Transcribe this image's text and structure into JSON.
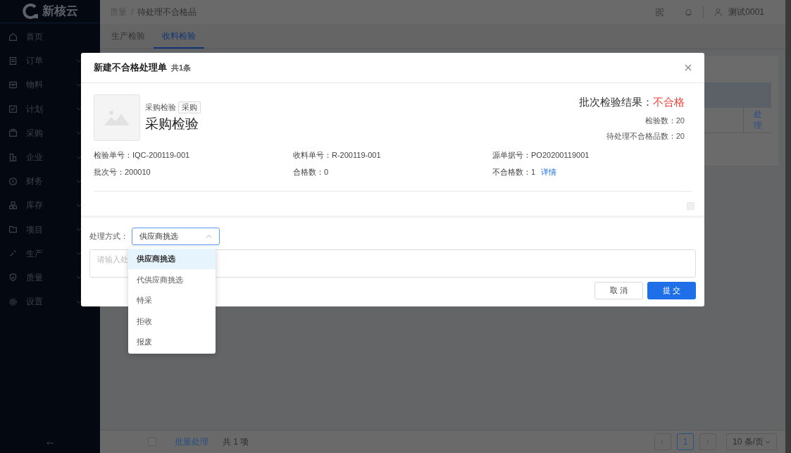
{
  "brand": {
    "name": "新核云"
  },
  "sidebar": {
    "items": [
      {
        "label": "首页",
        "expandable": false
      },
      {
        "label": "订单",
        "expandable": true
      },
      {
        "label": "物料",
        "expandable": true
      },
      {
        "label": "计划",
        "expandable": true
      },
      {
        "label": "采购",
        "expandable": true
      },
      {
        "label": "企业",
        "expandable": true
      },
      {
        "label": "财务",
        "expandable": true
      },
      {
        "label": "库存",
        "expandable": true
      },
      {
        "label": "项目",
        "expandable": true
      },
      {
        "label": "生产",
        "expandable": true
      },
      {
        "label": "质量",
        "expandable": true
      },
      {
        "label": "设置",
        "expandable": true
      }
    ]
  },
  "header": {
    "breadcrumb": [
      "质量",
      "待处理不合格品"
    ],
    "separator": "/",
    "user": "测试0001"
  },
  "tabs": [
    {
      "label": "生产检验",
      "selected": false
    },
    {
      "label": "收料检验",
      "selected": true
    }
  ],
  "table": {
    "action": "处理"
  },
  "footer": {
    "select_all_checked": false,
    "batch": "批量处理",
    "total": "共 1 项",
    "pages": [
      {
        "label": "1",
        "selected": true
      }
    ],
    "page_size": "10 条/页"
  },
  "modal": {
    "title": "新建不合格处理单",
    "count": "共1条",
    "category": "采购检验",
    "tag": "采购",
    "heading": "采购检验",
    "result_label": "批次检验结果：",
    "result": "不合格",
    "stats": [
      {
        "label": "检验数：",
        "value": "20"
      },
      {
        "label": "待处理不合格品数：",
        "value": "20"
      }
    ],
    "fields": [
      {
        "label": "检验单号：",
        "value": "IQC-200119-001"
      },
      {
        "label": "收料单号：",
        "value": "R-200119-001"
      },
      {
        "label": "源单据号：",
        "value": "PO20200119001"
      },
      {
        "label": "批次号：",
        "value": "200010"
      },
      {
        "label": "合格数：",
        "value": "0"
      },
      {
        "label": "不合格数：",
        "value": "1",
        "link": "详情"
      }
    ],
    "method_label": "处理方式：",
    "method_value": "供应商挑选",
    "method_open": true,
    "options": [
      {
        "label": "供应商挑选",
        "selected": true
      },
      {
        "label": "代供应商挑选",
        "selected": false
      },
      {
        "label": "特采",
        "selected": false
      },
      {
        "label": "拒收",
        "selected": false
      },
      {
        "label": "报废",
        "selected": false
      }
    ],
    "remark_placeholder": "请输入处",
    "buttons": [
      {
        "label": "取 消",
        "kind": "default"
      },
      {
        "label": "提 交",
        "kind": "primary"
      }
    ]
  }
}
